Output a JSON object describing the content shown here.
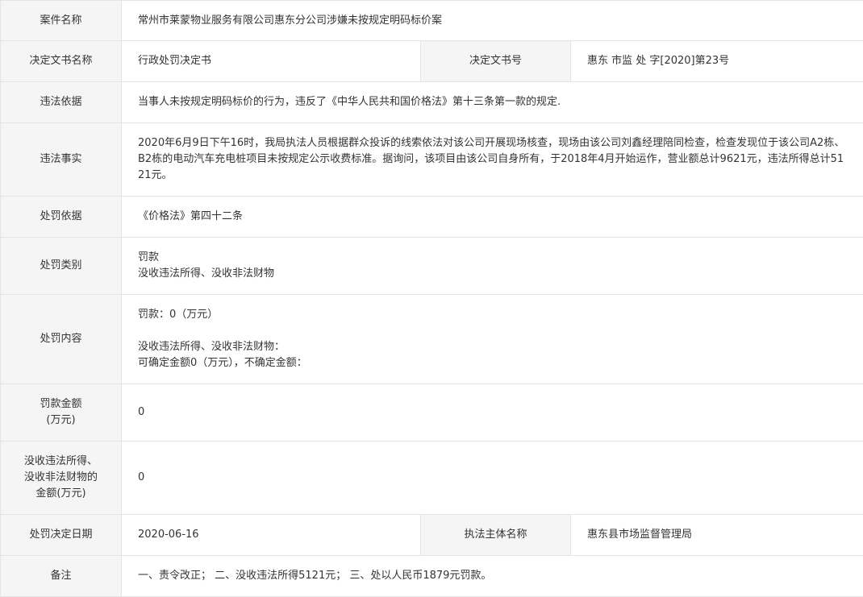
{
  "rows": {
    "case_name": {
      "label": "案件名称",
      "value": "常州市莱蒙物业服务有限公司惠东分公司涉嫌未按规定明码标价案"
    },
    "doc_name": {
      "label": "决定文书名称",
      "value": "行政处罚决定书"
    },
    "doc_number": {
      "label": "决定文书号",
      "value": "惠东 市监 处 字[2020]第23号"
    },
    "legal_basis": {
      "label": "违法依据",
      "value": "当事人未按规定明码标价的行为，违反了《中华人民共和国价格法》第十三条第一款的规定."
    },
    "facts": {
      "label": "违法事实",
      "value": "2020年6月9日下午16时，我局执法人员根据群众投诉的线索依法对该公司开展现场核查，现场由该公司刘鑫经理陪同检查，检查发现位于该公司A2栋、B2栋的电动汽车充电桩项目未按规定公示收费标准。据询问，该项目由该公司自身所有，于2018年4月开始运作，营业额总计9621元，违法所得总计5121元。"
    },
    "penalty_basis": {
      "label": "处罚依据",
      "value": "《价格法》第四十二条"
    },
    "penalty_type": {
      "label": "处罚类别",
      "line1": "罚款",
      "line2": "没收违法所得、没收非法财物"
    },
    "penalty_content": {
      "label": "处罚内容",
      "line1": "罚款：0（万元）",
      "line2": "没收违法所得、没收非法财物：",
      "line3": "可确定金额0（万元），不确定金额："
    },
    "fine_amount": {
      "label_line1": "罚款金额",
      "label_line2": "(万元)",
      "value": "0"
    },
    "confiscation_amount": {
      "label_line1": "没收违法所得、",
      "label_line2": "没收非法财物的",
      "label_line3": "金额(万元)",
      "value": "0"
    },
    "decision_date": {
      "label": "处罚决定日期",
      "value": "2020-06-16"
    },
    "enforcement_body": {
      "label": "执法主体名称",
      "value": "惠东县市场监督管理局"
    },
    "remarks": {
      "label": "备注",
      "value": "一、责令改正； 二、没收违法所得5121元； 三、处以人民币1879元罚款。"
    }
  }
}
